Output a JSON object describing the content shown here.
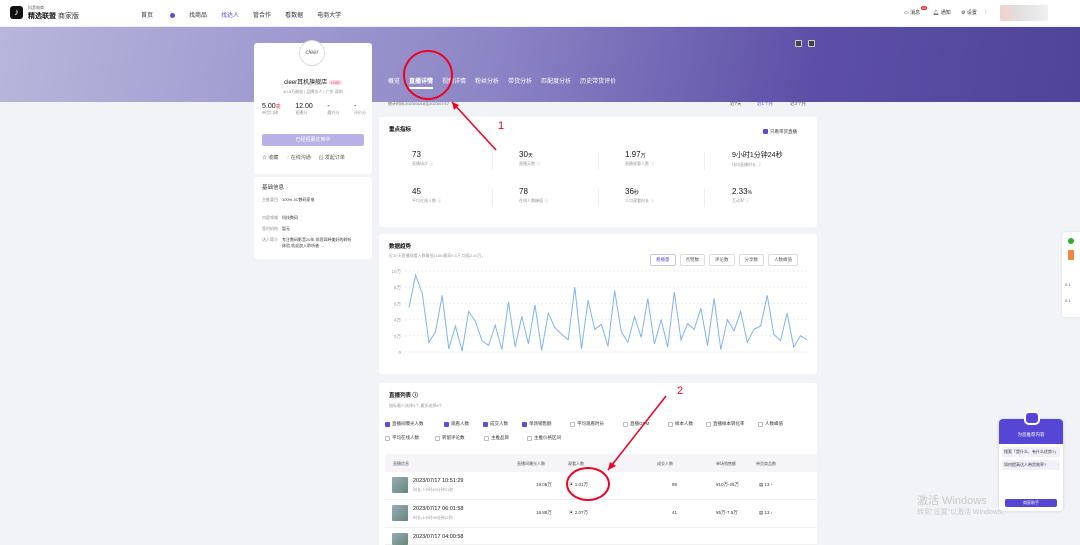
{
  "topnav": {
    "brand_small": "抖音电商",
    "brand": "精选联盟",
    "brand_sub": "商家版",
    "items": [
      "首页",
      "找商品",
      "找达人",
      "管合作",
      "看数据",
      "电商大学"
    ],
    "active_index": 2,
    "messages_label": "消息",
    "messages_count": "42",
    "notify_label": "通知",
    "settings_label": "设置"
  },
  "profile": {
    "avatar_text": "cleer",
    "name": "cleer耳机旗舰店",
    "live_badge": "LIVE",
    "meta": "40.5万粉丝 | 品牌达人 | 广东 深圳",
    "stats": [
      {
        "value": "5.00",
        "tag": "高",
        "label": "带货口碑"
      },
      {
        "value": "12.00",
        "tag": "",
        "label": "直播分"
      },
      {
        "value": "-",
        "tag": "",
        "label": "履约分"
      },
      {
        "value": "-",
        "tag": "",
        "label": "评价分"
      }
    ],
    "primary_button": "已经招募达到中",
    "actions": [
      "收藏",
      "在线沟通",
      "发起订单"
    ]
  },
  "basic_info": {
    "title": "基础信息",
    "rows": [
      {
        "key": "主推类目",
        "value": "100% 3C数码家电"
      },
      {
        "key": "内容领域",
        "value": "科技数码"
      },
      {
        "key": "签约机构",
        "value": "暂无"
      },
      {
        "key": "达人简介",
        "value": "专注数码影音20年,伴您耳畔美好的聆听体验,欢迎加入聆听者 →"
      }
    ]
  },
  "tabs": [
    "概览",
    "直播详情",
    "视频详情",
    "粉丝分析",
    "带货分析",
    "匹配度分析",
    "历史带货评价"
  ],
  "active_tab": 1,
  "stat_period": "统计时间:2023/06/18至2023/07/17",
  "ranges": [
    "近7天",
    "近1个月",
    "近3个月"
  ],
  "active_range": 1,
  "key_metrics": {
    "title": "重点指标",
    "toggle_label": "只看带货直播",
    "items": [
      {
        "value": "73",
        "unit": "",
        "label": "直播场次"
      },
      {
        "value": "30",
        "unit": "天",
        "label": "直播天数"
      },
      {
        "value": "1.97",
        "unit": "万",
        "label": "直播观看人数"
      },
      {
        "value": "9小时1分钟24秒",
        "unit": "",
        "label": "场均直播时长"
      },
      {
        "value": "45",
        "unit": "",
        "label": "平均在线人数"
      },
      {
        "value": "78",
        "unit": "",
        "label": "在线人数峰值"
      },
      {
        "value": "36",
        "unit": "秒",
        "label": "人均观看时长"
      },
      {
        "value": "2.33",
        "unit": "%",
        "label": "互动率"
      }
    ]
  },
  "trend": {
    "title": "数据趋势",
    "subtitle": "近30天直播观看人数最低1180,最高9.5万,均值2.40万。",
    "tabs": [
      "看播量",
      "点赞数",
      "评论数",
      "分享数",
      "人数峰值"
    ],
    "active_tab": 0
  },
  "chart_data": {
    "type": "line",
    "title": "",
    "xlabel": "",
    "ylabel": "",
    "ylim": [
      0,
      100000
    ],
    "y_ticks": [
      "10万",
      "8万",
      "6万",
      "4万",
      "2万",
      "0"
    ],
    "series": [
      {
        "values": [
          55000,
          95000,
          72000,
          12000,
          25000,
          70000,
          4000,
          32000,
          1200,
          50000,
          38000,
          14000,
          8000,
          33000,
          3000,
          62000,
          6000,
          44000,
          10000,
          58000,
          2000,
          48000,
          30000,
          22000,
          15000,
          80000,
          4000,
          64000,
          28000,
          34000,
          7000,
          76000,
          25000,
          12000,
          44000,
          18000,
          66000,
          10000,
          40000,
          6000,
          74000,
          15000,
          35000,
          28000,
          54000,
          8000,
          66000,
          3000,
          40000,
          26000,
          50000,
          12000,
          28000,
          32000,
          70000,
          22000,
          14000,
          48000,
          6000,
          20000,
          15000
        ]
      }
    ]
  },
  "live_list": {
    "title": "直播列表",
    "hint": "指标最少选择3个,最多选择8个",
    "filters": [
      {
        "label": "直播间曝光人数",
        "on": true
      },
      {
        "label": "观看人数",
        "on": true
      },
      {
        "label": "成交人数",
        "on": true
      },
      {
        "label": "单场销售额",
        "on": true
      },
      {
        "label": "平均观看时长",
        "on": false
      },
      {
        "label": "直播GPM",
        "on": false
      },
      {
        "label": "样本人数",
        "on": false
      },
      {
        "label": "直播样本转化率",
        "on": false
      },
      {
        "label": "人数峰值",
        "on": false
      },
      {
        "label": "平均在线人数",
        "on": false
      },
      {
        "label": "转留评论数",
        "on": false
      },
      {
        "label": "主推品目",
        "on": false
      },
      {
        "label": "主推价格区间",
        "on": false
      }
    ],
    "headers": [
      "直播信息",
      "直播间曝光人数",
      "观看人数",
      "成交人数",
      "单场销售额",
      "带货商品数"
    ],
    "rows": [
      {
        "date": "2023/07/17 10:51:29",
        "duration": "时长:7小时43分钟21秒",
        "exposure": "19.06万",
        "viewers": "1.01万",
        "buyers": "89",
        "sales": "¥10万-25万",
        "items": "13"
      },
      {
        "date": "2023/07/17 06:01:58",
        "duration": "时长:4小时39分钟11秒",
        "exposure": "18.88万",
        "viewers": "2.07万",
        "buyers": "41",
        "sales": "¥5万-7.5万",
        "items": "13"
      },
      {
        "date": "2023/07/17 04:00:58",
        "duration": "",
        "exposure": "",
        "viewers": "",
        "buyers": "",
        "sales": "",
        "items": ""
      }
    ]
  },
  "annotations": [
    "1",
    "2"
  ],
  "watermark": {
    "line1": "激活 Windows",
    "line2": "转到\"设置\"以激活 Windows。"
  },
  "helper": {
    "title": "为您推荐内容",
    "bubble1": "搜索「是什么、有什么优势?」",
    "bubble2": "如何提高达人带货效率?",
    "button": "商家助手"
  },
  "side_values": [
    "0.1",
    "0.1"
  ]
}
